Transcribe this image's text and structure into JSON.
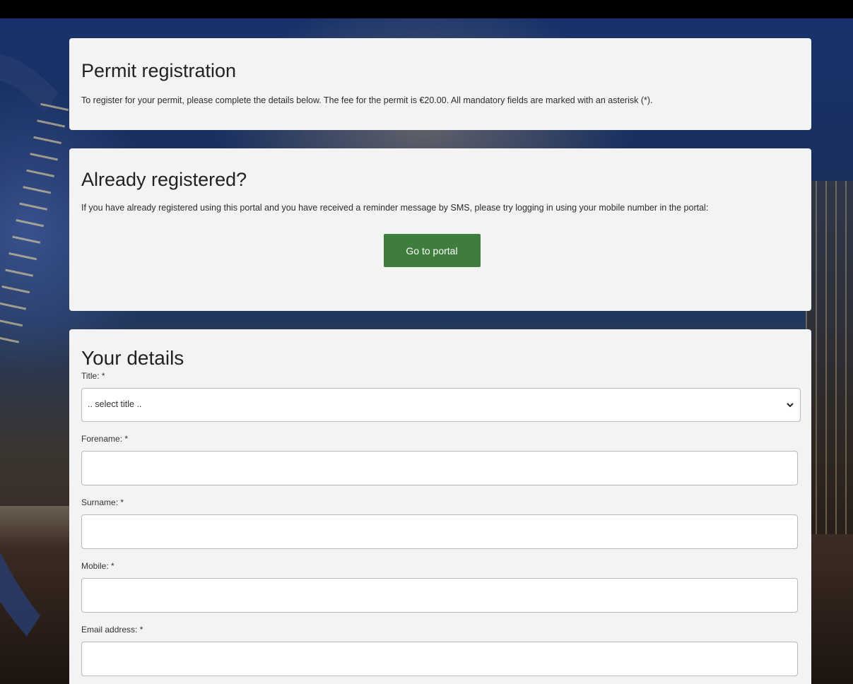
{
  "permit": {
    "heading": "Permit registration",
    "description": "To register for your permit, please complete the details below. The fee for the permit is €20.00. All mandatory fields are marked with an asterisk (*)."
  },
  "registered": {
    "heading": "Already registered?",
    "description": "If you have already registered using this portal and you have received a reminder message by SMS, please try logging in using your mobile number in the portal:",
    "button_label": "Go to portal"
  },
  "details": {
    "heading": "Your details",
    "title_label": "Title: *",
    "title_selected": ".. select title ..",
    "forename_label": "Forename: *",
    "forename_value": "",
    "surname_label": "Surname: *",
    "surname_value": "",
    "mobile_label": "Mobile: *",
    "mobile_value": "",
    "email_label": "Email address: *",
    "email_value": ""
  },
  "colors": {
    "button": "#3e7d3c",
    "card": "#f3f3f3"
  }
}
